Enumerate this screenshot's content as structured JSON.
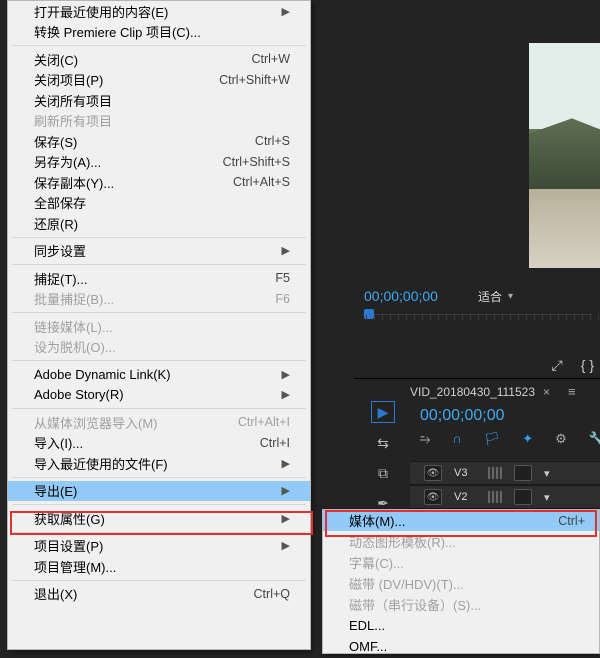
{
  "colors": {
    "accent": "#3fa9f5",
    "highlight": "#e03030",
    "menu_highlight": "#91c9f7"
  },
  "file_menu": [
    {
      "label": "打开最近使用的内容(E)",
      "shortcut": "",
      "type": "submenu",
      "enabled": true
    },
    {
      "label": "转换 Premiere Clip 项目(C)...",
      "shortcut": "",
      "type": "item",
      "enabled": true
    },
    {
      "type": "sep"
    },
    {
      "label": "关闭(C)",
      "shortcut": "Ctrl+W",
      "type": "item",
      "enabled": true
    },
    {
      "label": "关闭项目(P)",
      "shortcut": "Ctrl+Shift+W",
      "type": "item",
      "enabled": true
    },
    {
      "label": "关闭所有项目",
      "shortcut": "",
      "type": "item",
      "enabled": true
    },
    {
      "label": "刷新所有项目",
      "shortcut": "",
      "type": "item",
      "enabled": false
    },
    {
      "label": "保存(S)",
      "shortcut": "Ctrl+S",
      "type": "item",
      "enabled": true
    },
    {
      "label": "另存为(A)...",
      "shortcut": "Ctrl+Shift+S",
      "type": "item",
      "enabled": true
    },
    {
      "label": "保存副本(Y)...",
      "shortcut": "Ctrl+Alt+S",
      "type": "item",
      "enabled": true
    },
    {
      "label": "全部保存",
      "shortcut": "",
      "type": "item",
      "enabled": true
    },
    {
      "label": "还原(R)",
      "shortcut": "",
      "type": "item",
      "enabled": true
    },
    {
      "type": "sep"
    },
    {
      "label": "同步设置",
      "shortcut": "",
      "type": "submenu",
      "enabled": true
    },
    {
      "type": "sep"
    },
    {
      "label": "捕捉(T)...",
      "shortcut": "F5",
      "type": "item",
      "enabled": true
    },
    {
      "label": "批量捕捉(B)...",
      "shortcut": "F6",
      "type": "item",
      "enabled": false
    },
    {
      "type": "sep"
    },
    {
      "label": "链接媒体(L)...",
      "shortcut": "",
      "type": "item",
      "enabled": false
    },
    {
      "label": "设为脱机(O)...",
      "shortcut": "",
      "type": "item",
      "enabled": false
    },
    {
      "type": "sep"
    },
    {
      "label": "Adobe Dynamic Link(K)",
      "shortcut": "",
      "type": "submenu",
      "enabled": true
    },
    {
      "label": "Adobe Story(R)",
      "shortcut": "",
      "type": "submenu",
      "enabled": true
    },
    {
      "type": "sep"
    },
    {
      "label": "从媒体浏览器导入(M)",
      "shortcut": "Ctrl+Alt+I",
      "type": "item",
      "enabled": false
    },
    {
      "label": "导入(I)...",
      "shortcut": "Ctrl+I",
      "type": "item",
      "enabled": true
    },
    {
      "label": "导入最近使用的文件(F)",
      "shortcut": "",
      "type": "submenu",
      "enabled": true
    },
    {
      "type": "sep"
    },
    {
      "label": "导出(E)",
      "shortcut": "",
      "type": "submenu",
      "enabled": true,
      "highlight": true
    },
    {
      "type": "sep"
    },
    {
      "label": "获取属性(G)",
      "shortcut": "",
      "type": "submenu",
      "enabled": true
    },
    {
      "type": "sep"
    },
    {
      "label": "项目设置(P)",
      "shortcut": "",
      "type": "submenu",
      "enabled": true
    },
    {
      "label": "项目管理(M)...",
      "shortcut": "",
      "type": "item",
      "enabled": true
    },
    {
      "type": "sep"
    },
    {
      "label": "退出(X)",
      "shortcut": "Ctrl+Q",
      "type": "item",
      "enabled": true
    }
  ],
  "export_menu": [
    {
      "label": "媒体(M)...",
      "shortcut": "Ctrl+",
      "highlight": true,
      "enabled": true
    },
    {
      "label": "动态图形模板(R)...",
      "shortcut": "",
      "enabled": false
    },
    {
      "label": "字幕(C)...",
      "shortcut": "",
      "enabled": false
    },
    {
      "label": "磁带 (DV/HDV)(T)...",
      "shortcut": "",
      "enabled": false
    },
    {
      "label": "磁带（串行设备）(S)...",
      "shortcut": "",
      "enabled": false
    },
    {
      "label": "EDL...",
      "shortcut": "",
      "enabled": true
    },
    {
      "label": "OMF...",
      "shortcut": "",
      "enabled": true
    }
  ],
  "program": {
    "timecode": "00;00;00;00",
    "fit_label": "适合"
  },
  "timeline": {
    "tab_name": "VID_20180430_111523",
    "timecode": "00;00;00;00",
    "tracks": {
      "v3": "V3",
      "v2": "V2"
    },
    "tools": {
      "selection": "▶",
      "track_select": "⇆",
      "ripple": "⧉",
      "pen": "✒"
    },
    "icons": {
      "snap": "⥲",
      "magnet": "∩",
      "link": "🏳",
      "marker": "✦",
      "settings": "⚙",
      "wrench": "🔧"
    }
  },
  "corner": {
    "a": "⤢",
    "b": "{ }"
  }
}
